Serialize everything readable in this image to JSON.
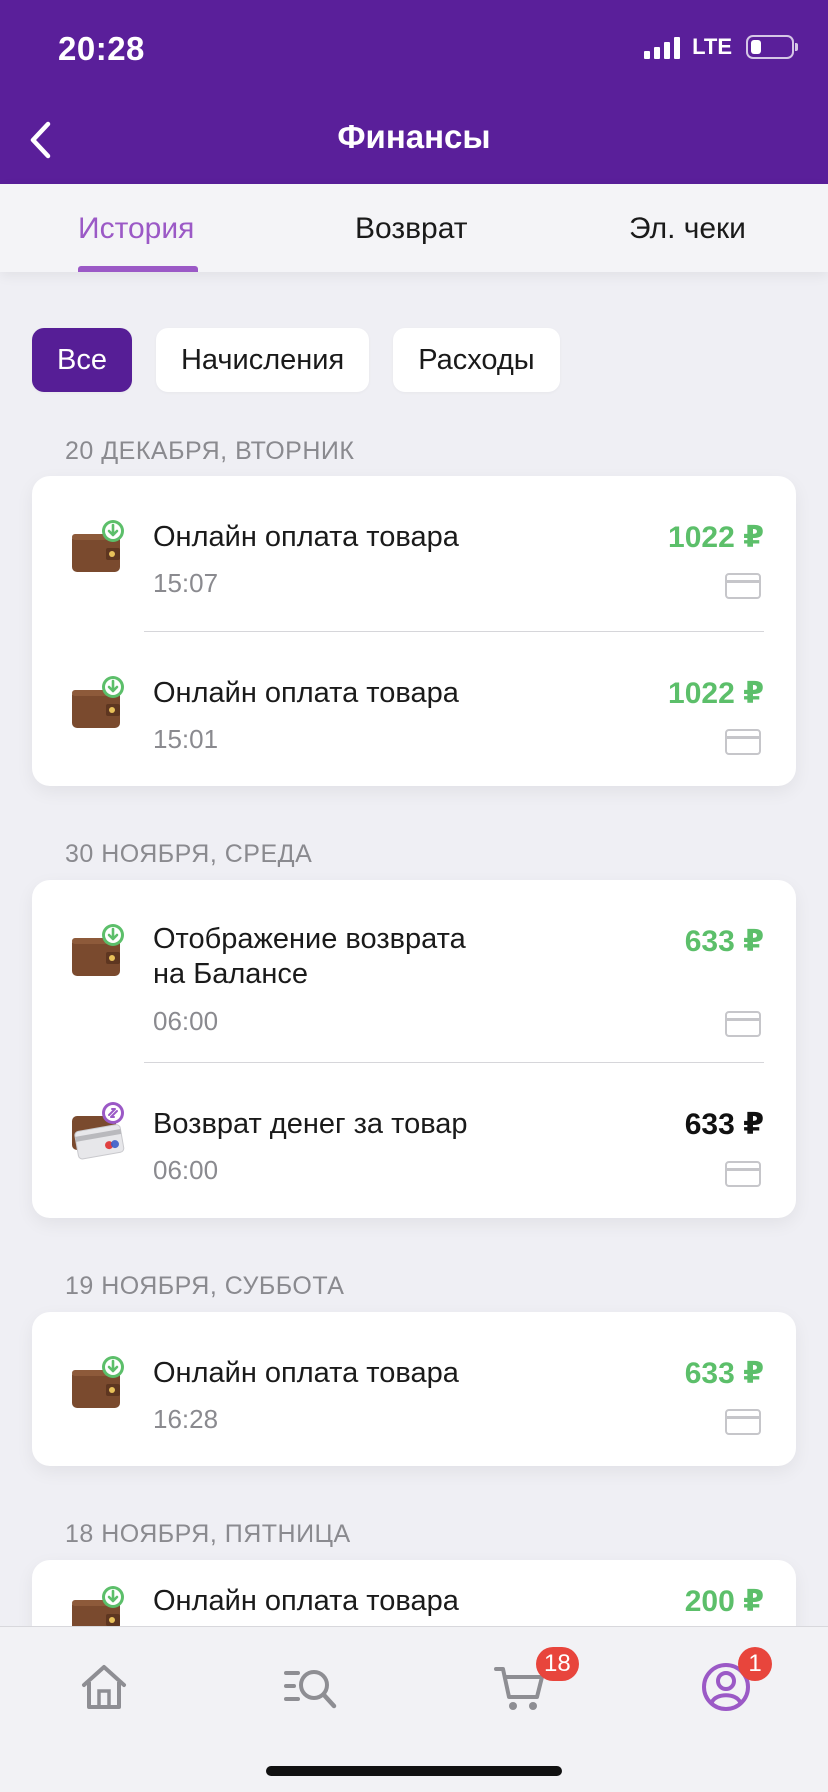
{
  "status_bar": {
    "time": "20:28",
    "network": "LTE"
  },
  "header": {
    "title": "Финансы"
  },
  "tabs": [
    {
      "label": "История",
      "active": true
    },
    {
      "label": "Возврат",
      "active": false
    },
    {
      "label": "Эл. чеки",
      "active": false
    }
  ],
  "filters": [
    {
      "label": "Все",
      "active": true
    },
    {
      "label": "Начисления",
      "active": false
    },
    {
      "label": "Расходы",
      "active": false
    }
  ],
  "groups": [
    {
      "date": "20 ДЕКАБРЯ, ВТОРНИК",
      "items": [
        {
          "title": "Онлайн оплата товара",
          "time": "15:07",
          "amount": "1022 ₽",
          "amount_color": "green",
          "icon": "wallet-deposit-icon"
        },
        {
          "title": "Онлайн оплата товара",
          "time": "15:01",
          "amount": "1022 ₽",
          "amount_color": "green",
          "icon": "wallet-deposit-icon"
        }
      ]
    },
    {
      "date": "30 НОЯБРЯ, СРЕДА",
      "items": [
        {
          "title_line1": "Отображение возврата",
          "title_line2": "на Балансе",
          "time": "06:00",
          "amount": "633 ₽",
          "amount_color": "green",
          "icon": "wallet-deposit-icon"
        },
        {
          "title": "Возврат денег за товар",
          "time": "06:00",
          "amount": "633 ₽",
          "amount_color": "black",
          "icon": "wallet-card-refund-icon"
        }
      ]
    },
    {
      "date": "19 НОЯБРЯ, СУББОТА",
      "items": [
        {
          "title": "Онлайн оплата товара",
          "time": "16:28",
          "amount": "633 ₽",
          "amount_color": "green",
          "icon": "wallet-deposit-icon"
        }
      ]
    },
    {
      "date": "18 НОЯБРЯ, ПЯТНИЦА",
      "items": [
        {
          "title": "Онлайн оплата товара",
          "amount": "200 ₽",
          "amount_color": "green",
          "icon": "wallet-deposit-icon"
        }
      ]
    }
  ],
  "bottom_nav": {
    "items": [
      "home-icon",
      "catalog-search-icon",
      "cart-icon",
      "profile-icon"
    ],
    "cart_badge": "18",
    "profile_badge": "1"
  },
  "colors": {
    "brand": "#5a1f9a",
    "accent": "#9b59c6",
    "income": "#5cbf6a",
    "badge": "#e8453c"
  }
}
